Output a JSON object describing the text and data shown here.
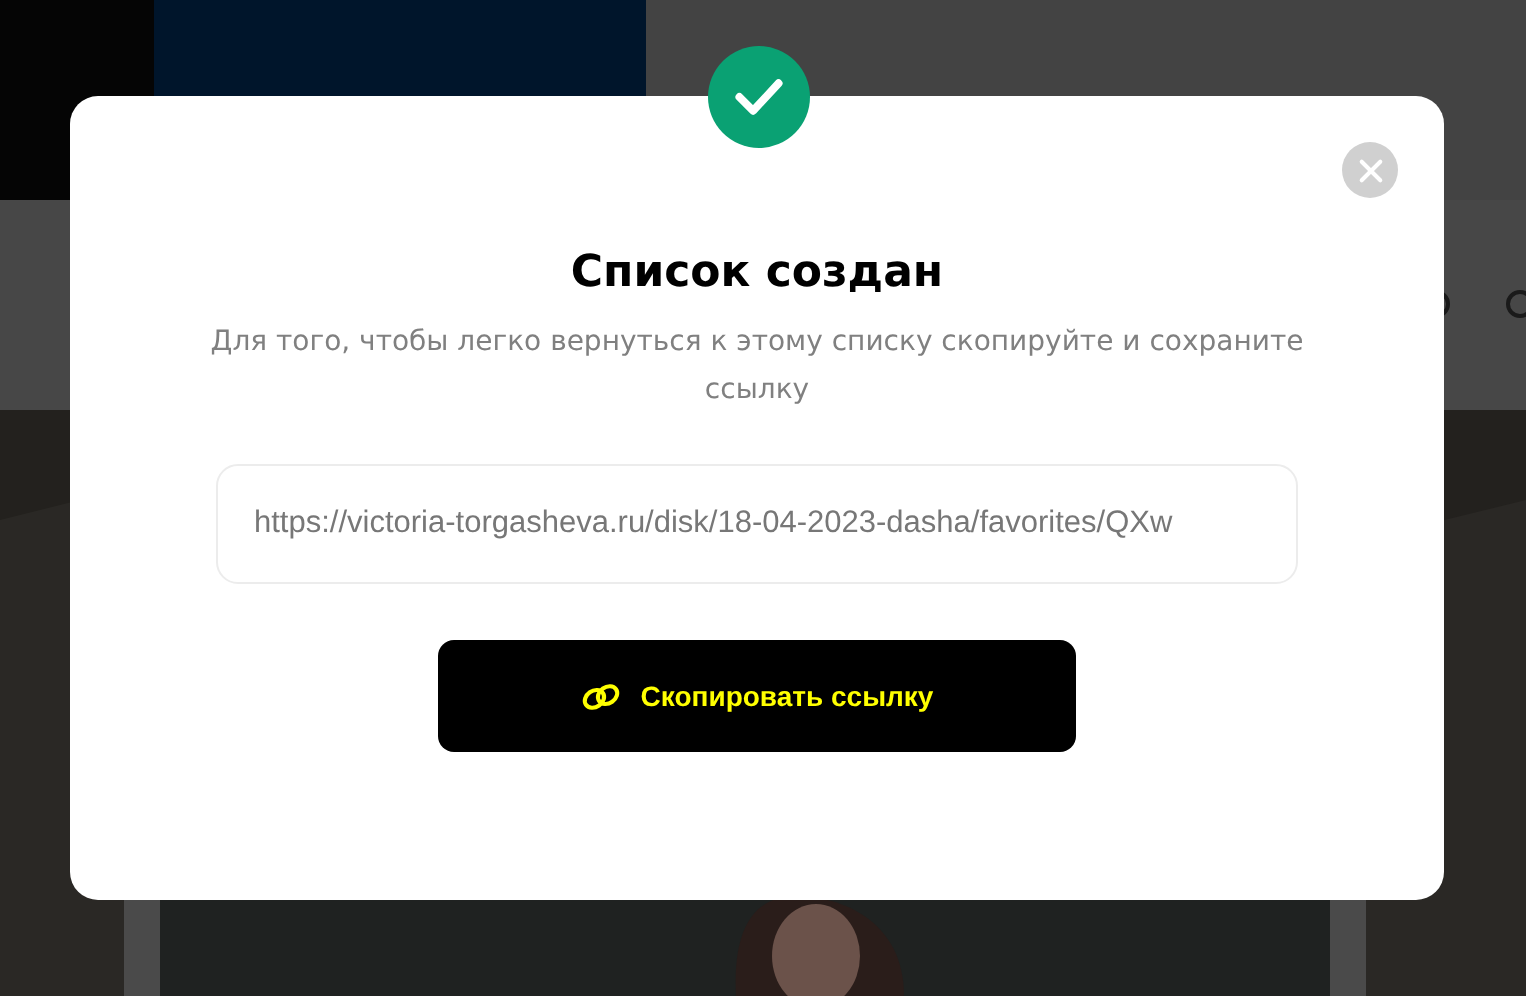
{
  "modal": {
    "title": "Список создан",
    "message": "Для того, чтобы легко вернуться к этому списку скопируйте и сохраните ссылку",
    "link_field": {
      "value": "https://victoria-torgasheva.ru/disk/18-04-2023-dasha/favorites/QXw"
    },
    "copy_button": {
      "label": "Скопировать ссылку"
    }
  }
}
